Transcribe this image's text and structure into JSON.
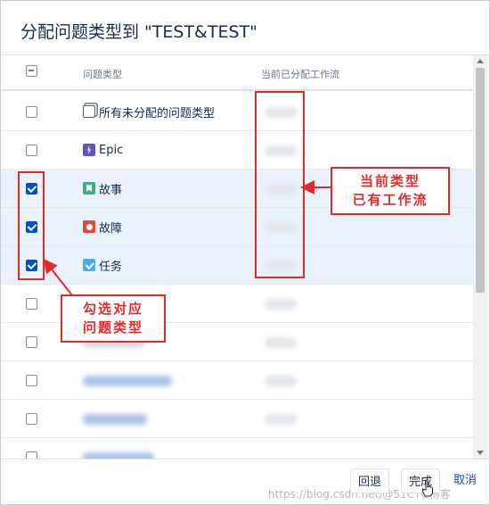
{
  "dialog": {
    "title": "分配问题类型到 \"TEST&TEST\""
  },
  "table": {
    "headers": {
      "type": "问题类型",
      "workflow": "当前已分配工作流"
    },
    "rows": [
      {
        "label": "所有未分配的问题类型",
        "icon": "stacked-pages-icon",
        "checked": false
      },
      {
        "label": "Epic",
        "icon": "lightning-icon",
        "checked": false
      },
      {
        "label": "故事",
        "icon": "bookmark-icon",
        "checked": true
      },
      {
        "label": "故障",
        "icon": "bug-dot-icon",
        "checked": true
      },
      {
        "label": "任务",
        "icon": "checkmark-icon",
        "checked": true
      }
    ]
  },
  "footer": {
    "back_label": "回退",
    "done_label": "完成",
    "cancel_label": "取消",
    "watermark": "https://blog.csdn.net/@51CTO博客"
  },
  "annotations": {
    "workflow_note_line1": "当前类型",
    "workflow_note_line2": "已有工作流",
    "checkbox_note_line1": "勾选对应",
    "checkbox_note_line2": "问题类型"
  },
  "colors": {
    "accent": "#0052cc",
    "annotation_red": "#e12b2b",
    "selected_row": "#eaf2fc"
  }
}
